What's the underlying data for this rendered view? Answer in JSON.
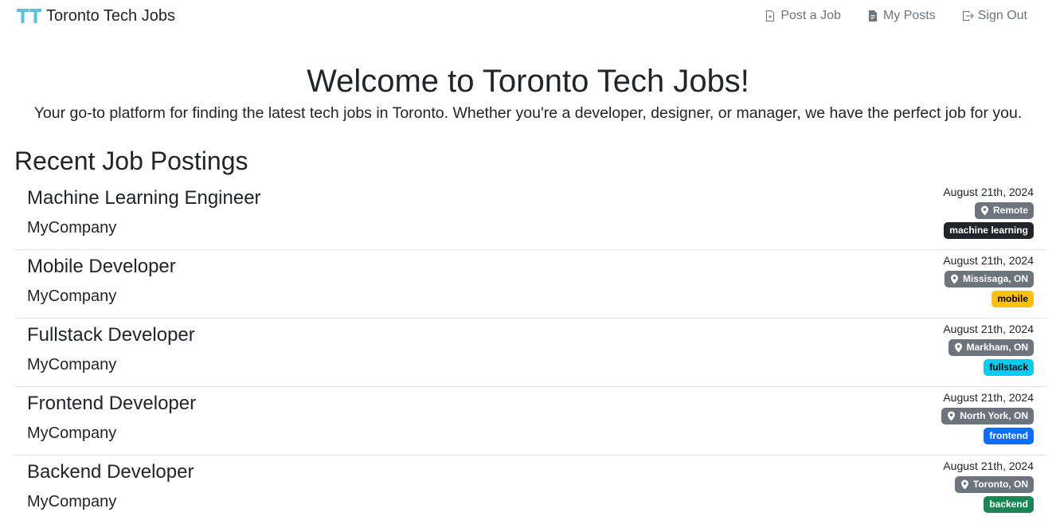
{
  "app": {
    "name": "Toronto Tech Jobs",
    "logo_text": "TT"
  },
  "nav": {
    "items": [
      {
        "label": "Post a Job",
        "icon": "file-plus-icon"
      },
      {
        "label": "My Posts",
        "icon": "file-text-icon"
      },
      {
        "label": "Sign Out",
        "icon": "sign-out-icon"
      }
    ]
  },
  "hero": {
    "title": "Welcome to Toronto Tech Jobs!",
    "subtitle": "Your go-to platform for finding the latest tech jobs in Toronto. Whether you're a developer, designer, or manager, we have the perfect job for you."
  },
  "recent": {
    "heading": "Recent Job Postings",
    "jobs": [
      {
        "title": "Machine Learning Engineer",
        "company": "MyCompany",
        "date": "August 21th, 2024",
        "location": "Remote",
        "tag": "machine learning",
        "tag_color": "#212529",
        "tag_text_color": "#ffffff"
      },
      {
        "title": "Mobile Developer",
        "company": "MyCompany",
        "date": "August 21th, 2024",
        "location": "Missisaga, ON",
        "tag": "mobile",
        "tag_color": "#ffc107",
        "tag_text_color": "#000000"
      },
      {
        "title": "Fullstack Developer",
        "company": "MyCompany",
        "date": "August 21th, 2024",
        "location": "Markham, ON",
        "tag": "fullstack",
        "tag_color": "#0dcaf0",
        "tag_text_color": "#000000"
      },
      {
        "title": "Frontend Developer",
        "company": "MyCompany",
        "date": "August 21th, 2024",
        "location": "North York, ON",
        "tag": "frontend",
        "tag_color": "#0d6efd",
        "tag_text_color": "#ffffff"
      },
      {
        "title": "Backend Developer",
        "company": "MyCompany",
        "date": "August 21th, 2024",
        "location": "Toronto, ON",
        "tag": "backend",
        "tag_color": "#198754",
        "tag_text_color": "#ffffff"
      }
    ]
  },
  "colors": {
    "logo": "#5bc0de",
    "nav_link": "#6c757d",
    "location_badge": "#6c757d"
  }
}
